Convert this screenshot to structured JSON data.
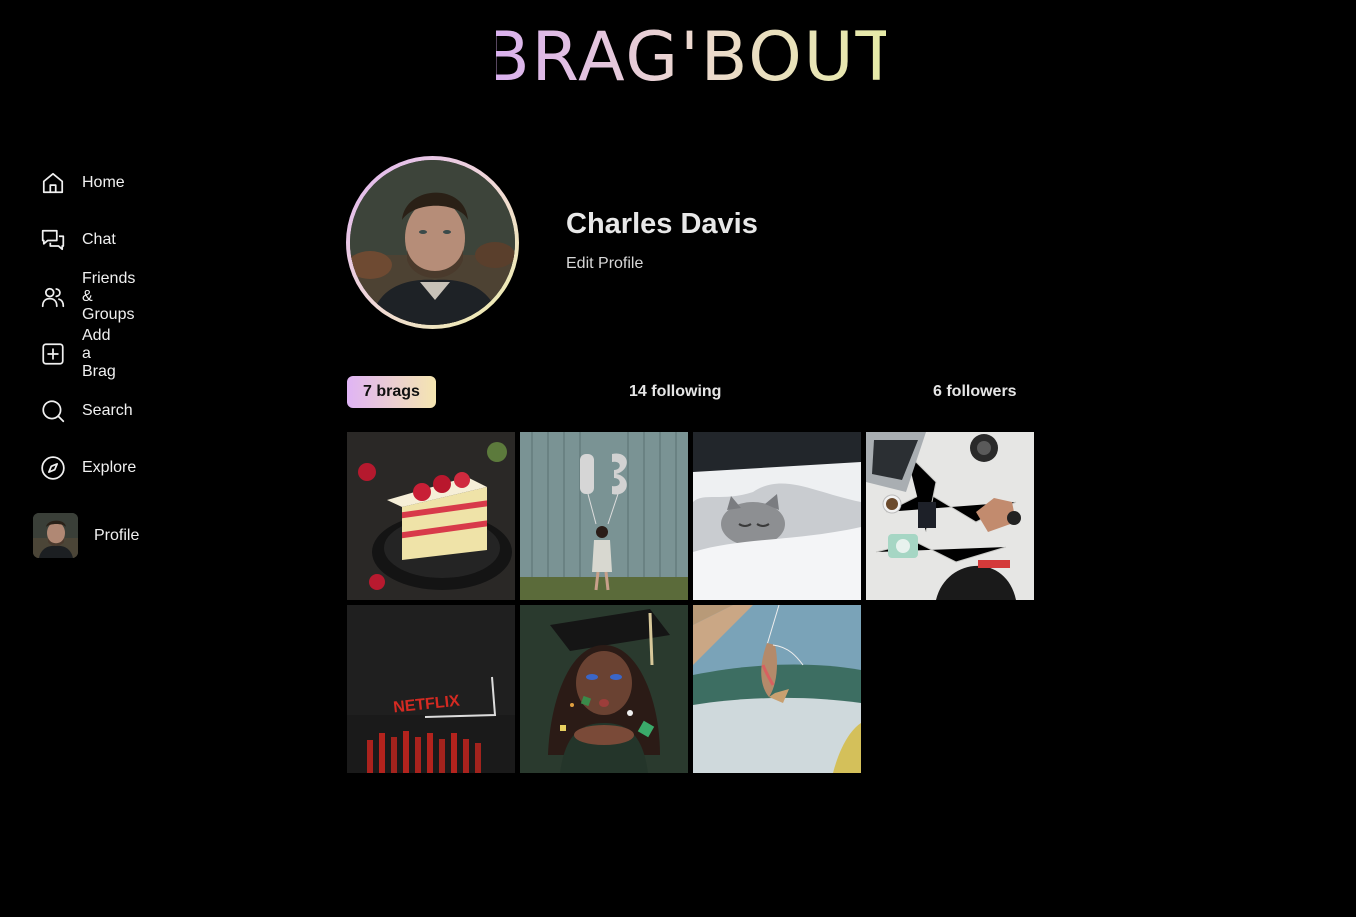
{
  "app": {
    "logo_text": "BRAG'BOUT"
  },
  "sidebar": {
    "items": [
      {
        "label": "Home",
        "icon": "home-icon"
      },
      {
        "label": "Chat",
        "icon": "chat-icon"
      },
      {
        "label": "Friends & Groups",
        "icon": "friends-icon"
      },
      {
        "label": "Add a Brag",
        "icon": "add-square-icon"
      },
      {
        "label": "Search",
        "icon": "search-icon"
      },
      {
        "label": "Explore",
        "icon": "compass-icon"
      }
    ],
    "profile_label": "Profile"
  },
  "profile": {
    "name": "Charles Davis",
    "edit_label": "Edit Profile"
  },
  "stats": {
    "brags": "7 brags",
    "following": "14 following",
    "followers": "6 followers"
  },
  "brags": [
    {
      "subject": "strawberry-cake"
    },
    {
      "subject": "birthday-balloons-18"
    },
    {
      "subject": "sleeping-cat"
    },
    {
      "subject": "travel-map-flatlay"
    },
    {
      "subject": "netflix-logo"
    },
    {
      "subject": "graduation-confetti"
    },
    {
      "subject": "fish-on-line"
    }
  ],
  "colors": {
    "background": "#000000",
    "accent_start": "#e0b4f5",
    "accent_end": "#f5e6b0",
    "text": "#e8e8e8"
  }
}
